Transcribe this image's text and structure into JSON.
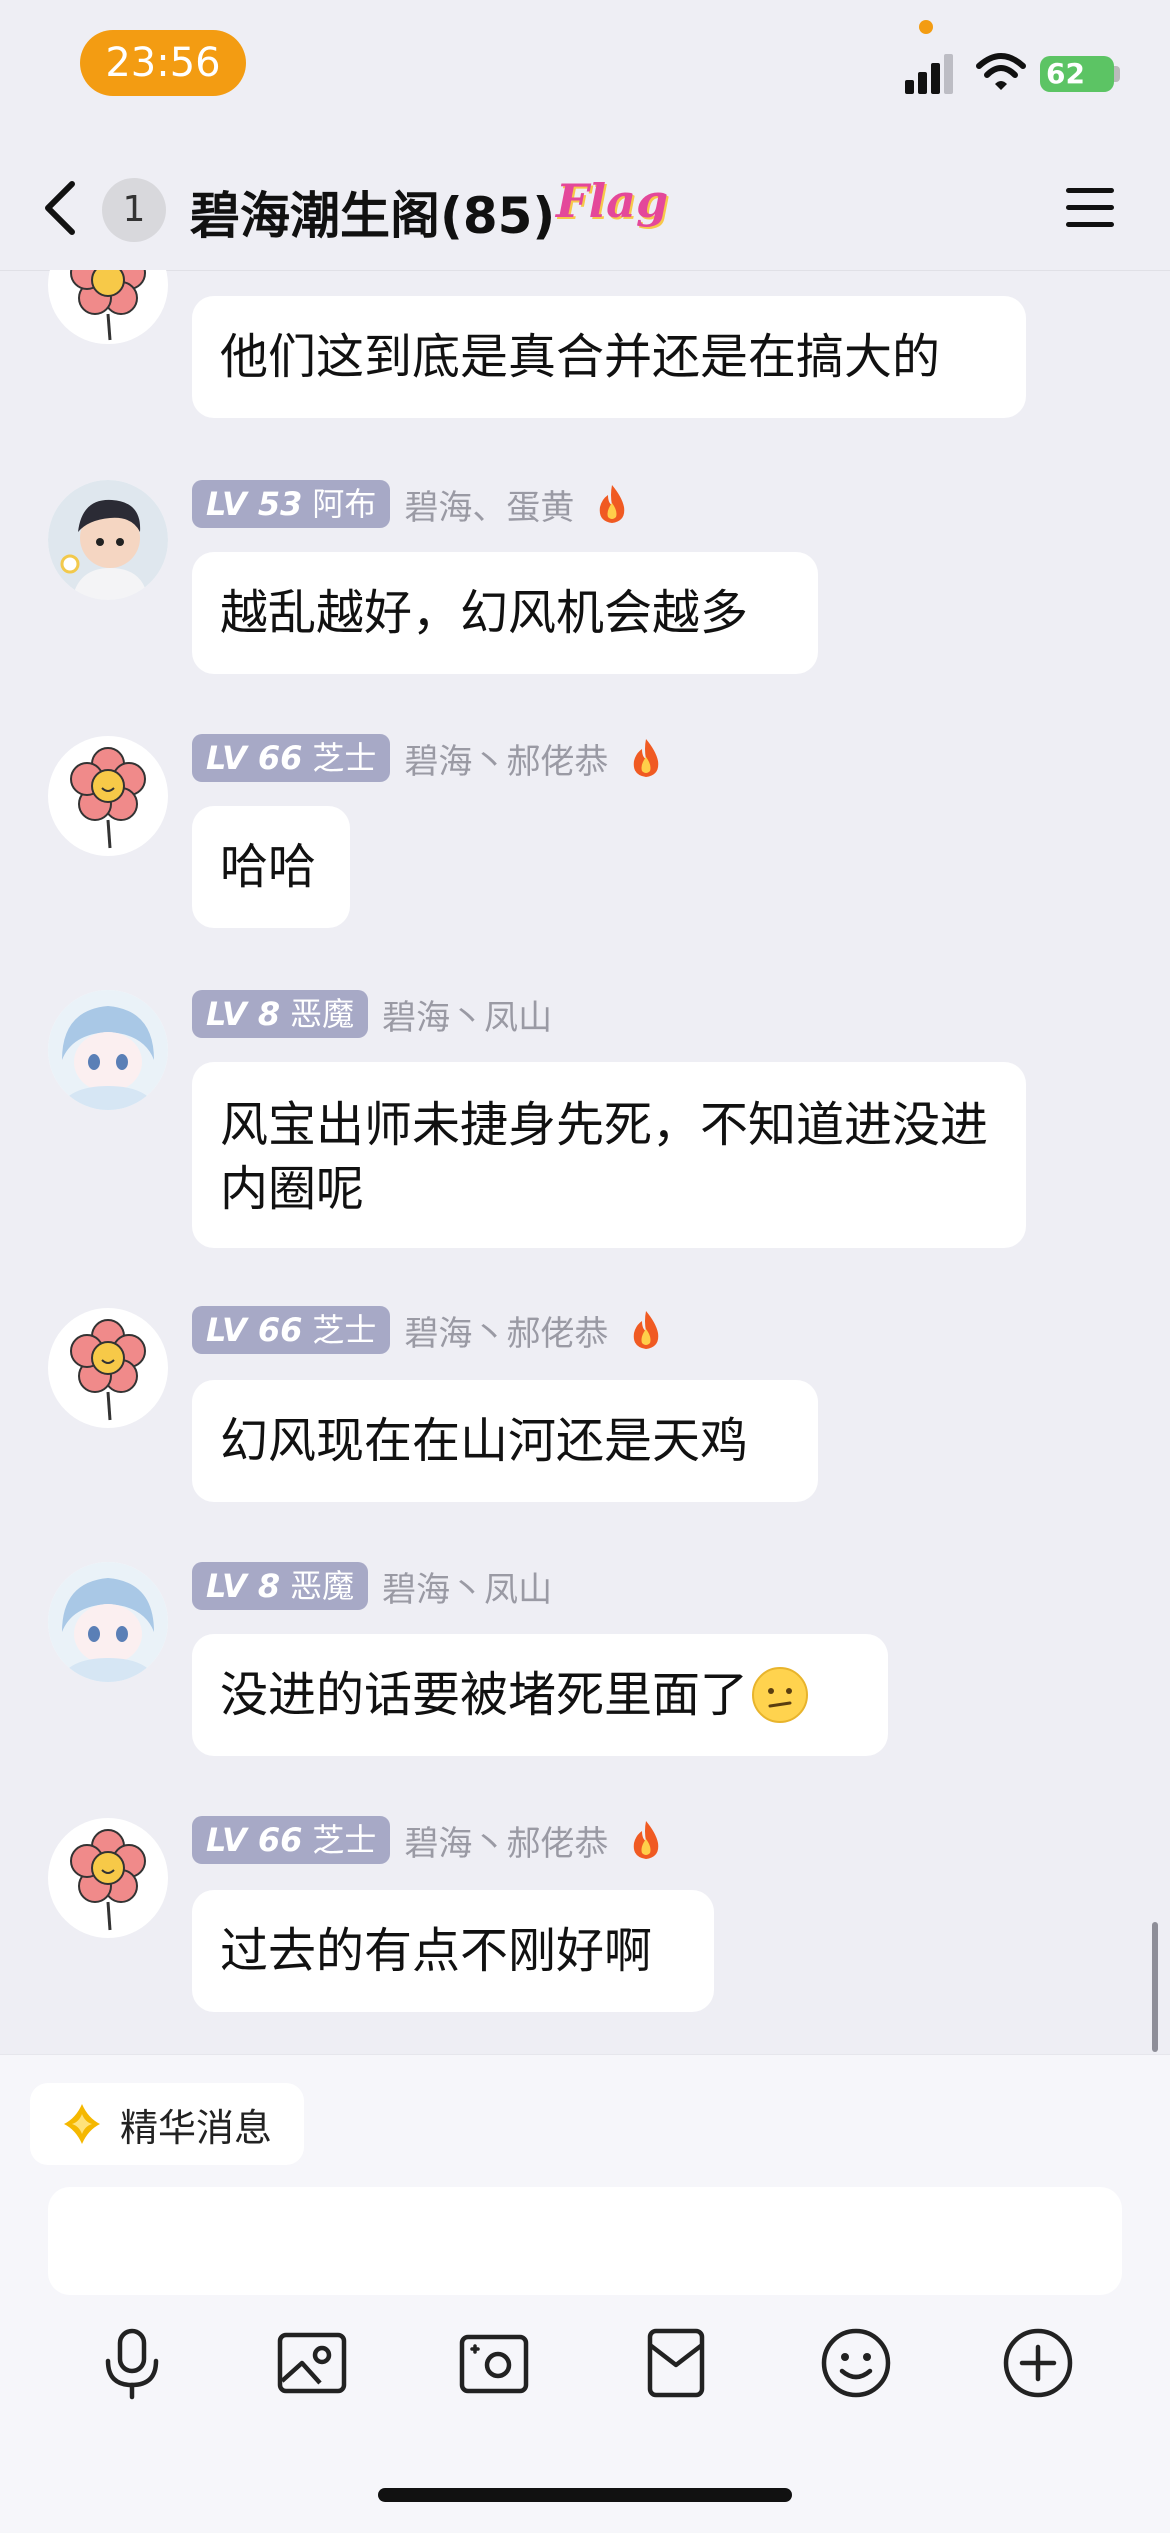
{
  "status_bar": {
    "time": "23:56",
    "battery": "62"
  },
  "nav": {
    "unread_count": "1",
    "title": "碧海潮生阁(85)",
    "badge_text": "Flag"
  },
  "messages": [
    {
      "sender": "",
      "level": "",
      "name": "",
      "group": "",
      "text": "他们这到底是真合并还是在搞大的",
      "fire": false
    },
    {
      "sender": "avatar-boy",
      "level": "LV 53",
      "name": "阿布",
      "group": "碧海、蛋黄",
      "text": "越乱越好，幻风机会越多",
      "fire": true
    },
    {
      "sender": "avatar-flower",
      "level": "LV 66",
      "name": "芝士",
      "group": "碧海丶郝佬恭",
      "text": "哈哈",
      "fire": true
    },
    {
      "sender": "avatar-anime",
      "level": "LV 8",
      "name": "恶魔",
      "group": "碧海丶凤山",
      "text": "风宝出师未捷身先死，不知道进没进内圈呢",
      "fire": false
    },
    {
      "sender": "avatar-flower",
      "level": "LV 66",
      "name": "芝士",
      "group": "碧海丶郝佬恭",
      "text": "幻风现在在山河还是天鸡",
      "fire": true
    },
    {
      "sender": "avatar-anime",
      "level": "LV 8",
      "name": "恶魔",
      "group": "碧海丶凤山",
      "text": "没进的话要被堵死里面了",
      "fire": false
    },
    {
      "sender": "avatar-flower",
      "level": "LV 66",
      "name": "芝士",
      "group": "碧海丶郝佬恭",
      "text": "过去的有点不刚好啊",
      "fire": true
    }
  ],
  "bottom": {
    "essence_label": "精华消息",
    "input_placeholder": ""
  },
  "toolbar": [
    "microphone-icon",
    "photo-icon",
    "camera-icon",
    "red-packet-icon",
    "emoji-icon",
    "plus-icon"
  ],
  "colors": {
    "accent_orange": "#f39c12",
    "level_badge": "#a7a9c6",
    "background": "#eeeef4"
  }
}
